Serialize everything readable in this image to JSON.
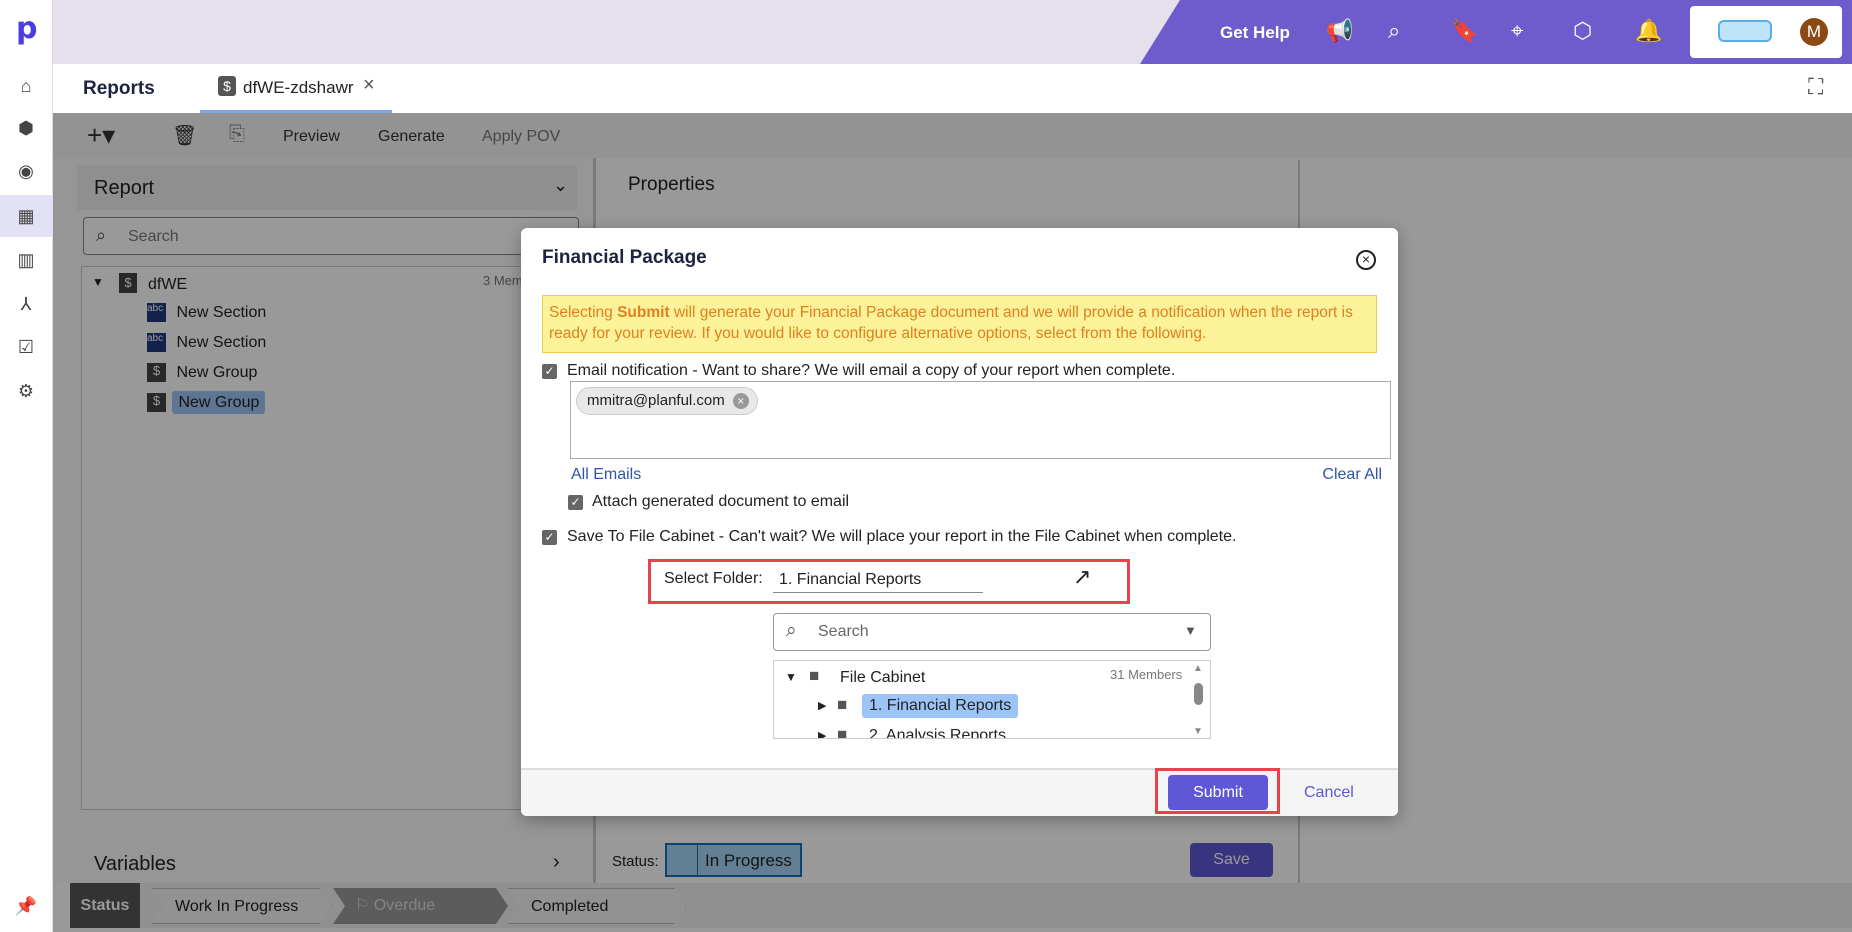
{
  "header": {
    "get_help": "Get Help",
    "avatar_initial": "M",
    "brand_color": "#6f5ccc"
  },
  "tabs": {
    "section_title": "Reports",
    "open_tab": "dfWE-zdshawr"
  },
  "toolbar": {
    "preview": "Preview",
    "generate": "Generate",
    "apply_pov": "Apply POV"
  },
  "report_panel": {
    "title": "Report",
    "search_placeholder": "Search",
    "tree": {
      "root": "dfWE",
      "root_count": "3 Mem",
      "items": [
        "New Section",
        "New Section",
        "New Group",
        "New Group"
      ]
    },
    "variables": "Variables"
  },
  "properties": {
    "title": "Properties",
    "status_label": "Status:",
    "status_value": "In Progress",
    "save": "Save"
  },
  "status_bar": {
    "label": "Status",
    "steps": [
      "Work In Progress",
      "Overdue",
      "Completed"
    ]
  },
  "dialog": {
    "title": "Financial Package",
    "notice_pre": "Selecting ",
    "notice_bold": "Submit",
    "notice_post": " will generate your Financial Package document and we will provide a notification when the report is ready for your review. If you would like to configure alternative options, select from the following.",
    "email_label": "Email notification - Want to share? We will email a copy of your report when complete.",
    "email_chip": "mmitra@planful.com",
    "all_emails": "All Emails",
    "clear_all": "Clear All",
    "attach_label": "Attach generated document to email",
    "file_cabinet_label": "Save To File Cabinet - Can't wait? We will place your report in the File Cabinet when complete.",
    "select_folder_label": "Select Folder:",
    "select_folder_value": "1. Financial Reports",
    "search_placeholder": "Search",
    "tree": {
      "root": "File Cabinet",
      "count": "31 Members",
      "items": [
        "1. Financial Reports",
        "2. Analysis Reports"
      ]
    },
    "submit": "Submit",
    "cancel": "Cancel"
  }
}
